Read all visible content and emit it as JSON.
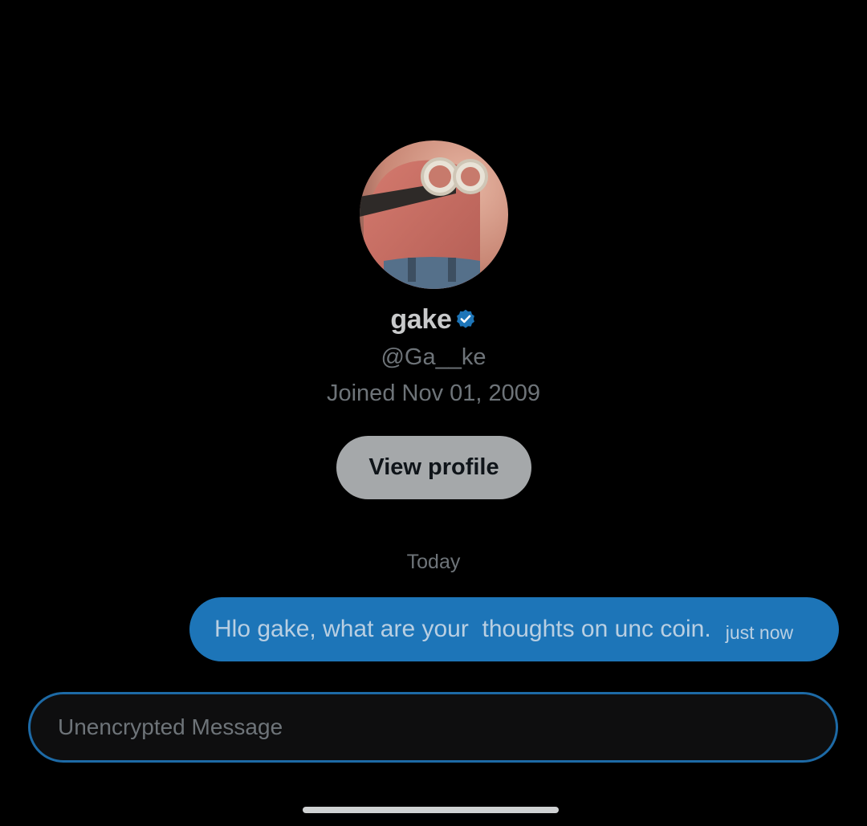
{
  "profile": {
    "display_name": "gake",
    "handle": "@Ga__ke",
    "joined": "Joined Nov 01, 2009",
    "verified_icon": "verified-badge-icon",
    "view_profile_label": "View profile"
  },
  "conversation": {
    "date_separator": "Today",
    "messages": [
      {
        "text": "Hlo gake, what are your  thoughts on unc coin.",
        "time": "just now",
        "direction": "outgoing"
      }
    ]
  },
  "composer": {
    "placeholder": "Unencrypted Message",
    "value": ""
  },
  "colors": {
    "background": "#000000",
    "accent": "#1d75b8",
    "muted_text": "#6e7479",
    "button_bg": "#a5a8aa"
  }
}
